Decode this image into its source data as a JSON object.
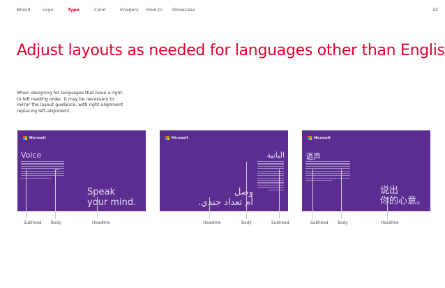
{
  "nav": {
    "items": [
      {
        "label": "Brand",
        "active": false
      },
      {
        "label": "Logo",
        "active": false
      },
      {
        "label": "Type",
        "active": true
      },
      {
        "label": "Color",
        "active": false
      },
      {
        "label": "Imagery",
        "active": false
      },
      {
        "label": "How-to",
        "active": false
      },
      {
        "label": "Showcase",
        "active": false
      }
    ],
    "page_number": "32"
  },
  "accent_color": "#e4002b",
  "panel_color": "#5c2d91",
  "title": "Adjust layouts as needed for languages other than English",
  "intro": "When designing for languages that have a right-to-left reading order, it may be necessary to mirror the layout guidance, with right-alignment replacing left-alignment.",
  "panels": [
    {
      "logo": "Microsoft",
      "subhead": "Voice",
      "headline_line1": "Speak",
      "headline_line2": "your mind.",
      "captions": [
        "Subhead",
        "Body",
        "Headline"
      ]
    },
    {
      "logo": "Microsoft",
      "subhead": "البانية",
      "headline_line1": "وصل",
      "headline_line2": "أم تعداد جندي.",
      "captions": [
        "Headline",
        "Body",
        "Subhead"
      ]
    },
    {
      "logo": "Microsoft",
      "subhead": "语声",
      "headline_line1": "说出",
      "headline_line2": "你的心意。",
      "captions": [
        "Subhead",
        "Body",
        "Headline"
      ]
    }
  ]
}
